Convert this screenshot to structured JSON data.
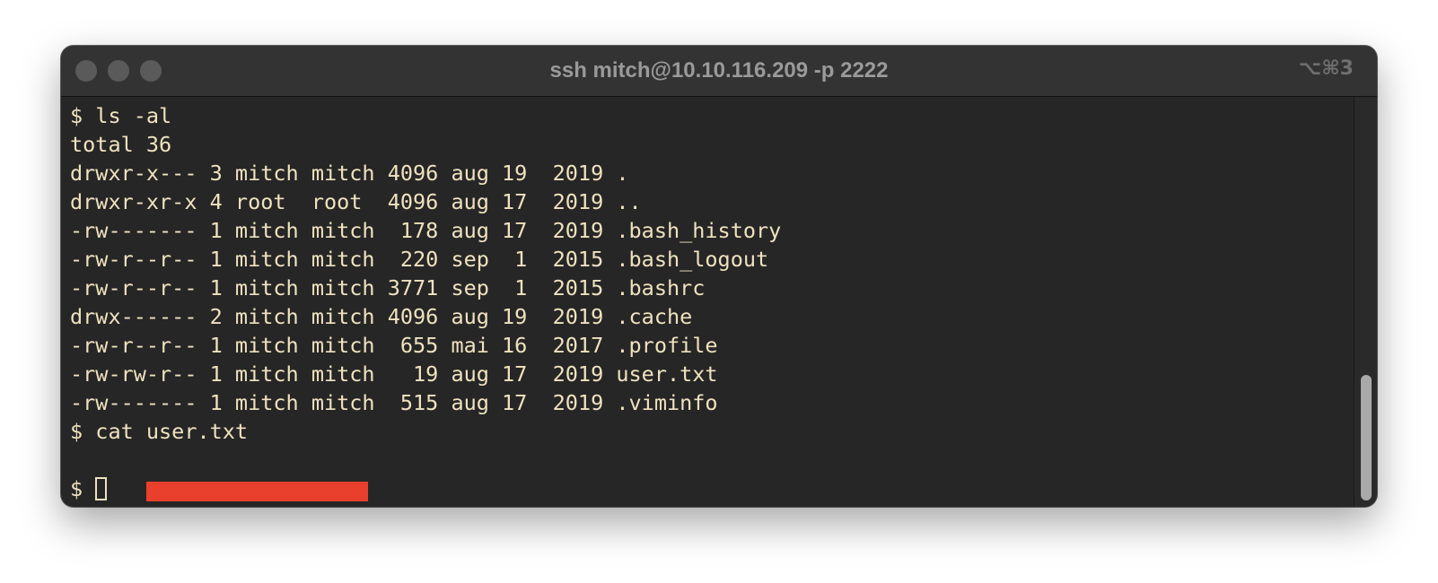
{
  "window": {
    "title": "ssh mitch@10.10.116.209 -p 2222",
    "shortcut": "⌥⌘3"
  },
  "terminal": {
    "lines": [
      "$ ls -al",
      "total 36",
      "drwxr-x--- 3 mitch mitch 4096 aug 19  2019 .",
      "drwxr-xr-x 4 root  root  4096 aug 17  2019 ..",
      "-rw------- 1 mitch mitch  178 aug 17  2019 .bash_history",
      "-rw-r--r-- 1 mitch mitch  220 sep  1  2015 .bash_logout",
      "-rw-r--r-- 1 mitch mitch 3771 sep  1  2015 .bashrc",
      "drwx------ 2 mitch mitch 4096 aug 19  2019 .cache",
      "-rw-r--r-- 1 mitch mitch  655 mai 16  2017 .profile",
      "-rw-rw-r-- 1 mitch mitch   19 aug 17  2019 user.txt",
      "-rw------- 1 mitch mitch  515 aug 17  2019 .viminfo",
      "$ cat user.txt"
    ],
    "prompt": "$ "
  },
  "colors": {
    "background": "#262626",
    "titlebar": "#333333",
    "text": "#efe2bf",
    "redaction": "#e8402c"
  },
  "icons": {
    "close": "traffic-light-close-icon",
    "minimize": "traffic-light-minimize-icon",
    "zoom": "traffic-light-zoom-icon"
  }
}
